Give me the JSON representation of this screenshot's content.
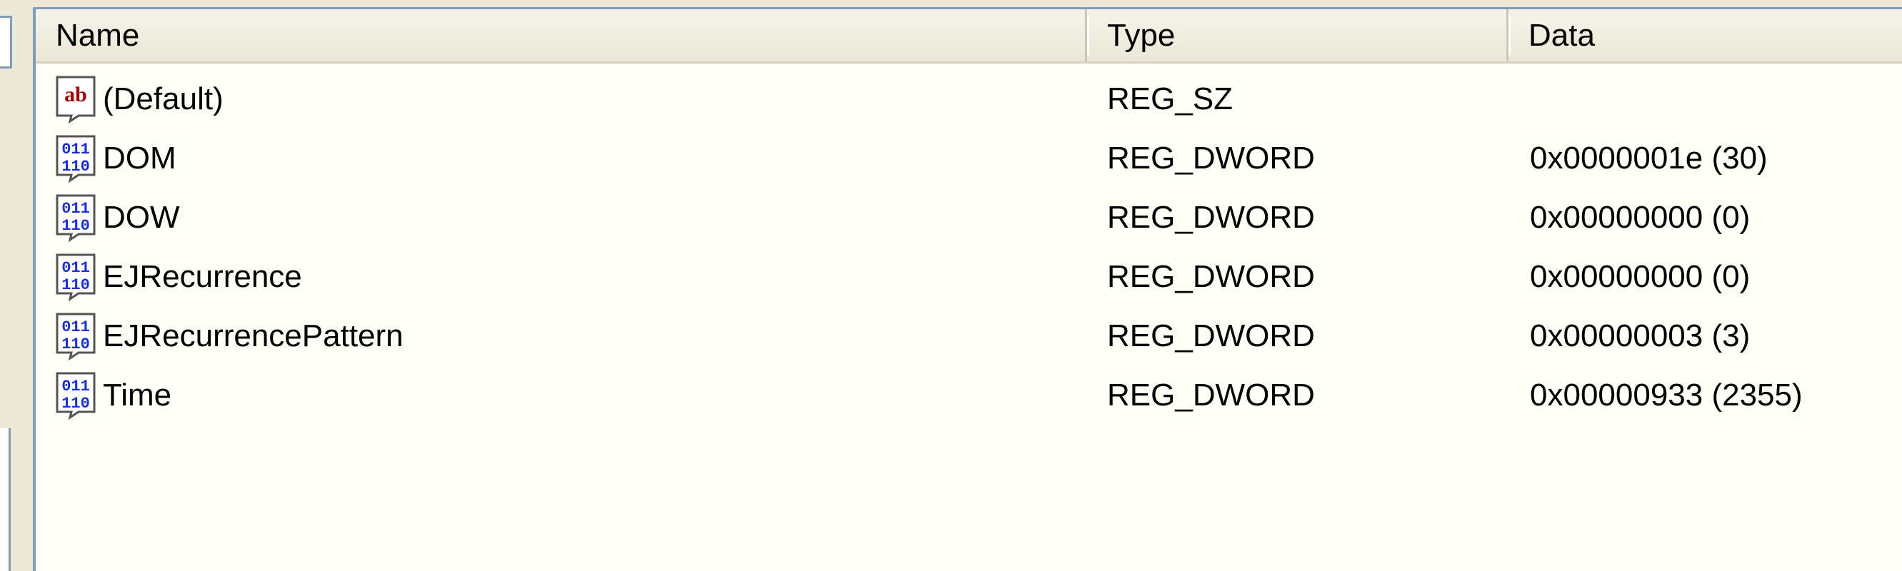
{
  "list": {
    "columns": {
      "name": "Name",
      "type": "Type",
      "data": "Data"
    },
    "rows": [
      {
        "icon": "string-value-icon",
        "name": "(Default)",
        "type": "REG_SZ",
        "data": ""
      },
      {
        "icon": "binary-value-icon",
        "name": "DOM",
        "type": "REG_DWORD",
        "data": "0x0000001e (30)"
      },
      {
        "icon": "binary-value-icon",
        "name": "DOW",
        "type": "REG_DWORD",
        "data": "0x00000000 (0)"
      },
      {
        "icon": "binary-value-icon",
        "name": "EJRecurrence",
        "type": "REG_DWORD",
        "data": "0x00000000 (0)"
      },
      {
        "icon": "binary-value-icon",
        "name": "EJRecurrencePattern",
        "type": "REG_DWORD",
        "data": "0x00000003 (3)"
      },
      {
        "icon": "binary-value-icon",
        "name": "Time",
        "type": "REG_DWORD",
        "data": "0x00000933 (2355)"
      }
    ]
  },
  "icons": {
    "string_value_text": "ab",
    "binary_value_text_top": "011",
    "binary_value_text_bottom": "110"
  },
  "colors": {
    "list_background": "#fffff7",
    "header_background": "#ebe8d7",
    "border": "#7f9db9",
    "string_icon": "#a00000",
    "binary_icon": "#1a2fd6"
  }
}
